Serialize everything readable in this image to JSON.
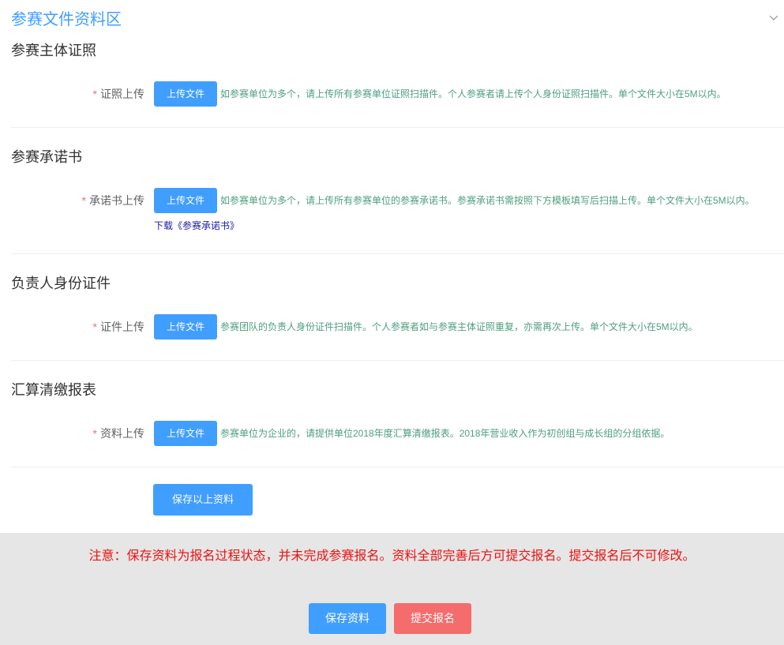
{
  "header": {
    "title": "参赛文件资料区",
    "toggle_icon": "chevron-down-icon"
  },
  "sections": [
    {
      "heading": "参赛主体证照",
      "required_mark": "*",
      "field_label": "证照上传",
      "upload_button": "上传文件",
      "hint": "如参赛单位为多个，请上传所有参赛单位证照扫描件。个人参赛者请上传个人身份证照扫描件。单个文件大小在5M以内。"
    },
    {
      "heading": "参赛承诺书",
      "required_mark": "*",
      "field_label": "承诺书上传",
      "upload_button": "上传文件",
      "hint": "如参赛单位为多个，请上传所有参赛单位的参赛承诺书。参赛承诺书需按照下方模板填写后扫描上传。单个文件大小在5M以内。",
      "download_link": "下载《参赛承诺书》"
    },
    {
      "heading": "负责人身份证件",
      "required_mark": "*",
      "field_label": "证件上传",
      "upload_button": "上传文件",
      "hint": "参赛团队的负责人身份证件扫描件。个人参赛者如与参赛主体证照重复，亦需再次上传。单个文件大小在5M以内。"
    },
    {
      "heading": "汇算清缴报表",
      "required_mark": "*",
      "field_label": "资料上传",
      "upload_button": "上传文件",
      "hint": "参赛单位为企业的，请提供单位2018年度汇算清缴报表。2018年营业收入作为初创组与成长组的分组依据。"
    }
  ],
  "save_section_button": "保存以上资料",
  "footer": {
    "notice": "注意：保存资料为报名过程状态，并未完成参赛报名。资料全部完善后方可提交报名。提交报名后不可修改。",
    "save_button": "保存资料",
    "submit_button": "提交报名"
  },
  "colors": {
    "primary": "#409eff",
    "danger": "#f56c6c",
    "hint": "#4e9e7f",
    "notice": "#ee1111",
    "link": "#1a1aa6",
    "footer_bg": "#e6e6e6"
  }
}
